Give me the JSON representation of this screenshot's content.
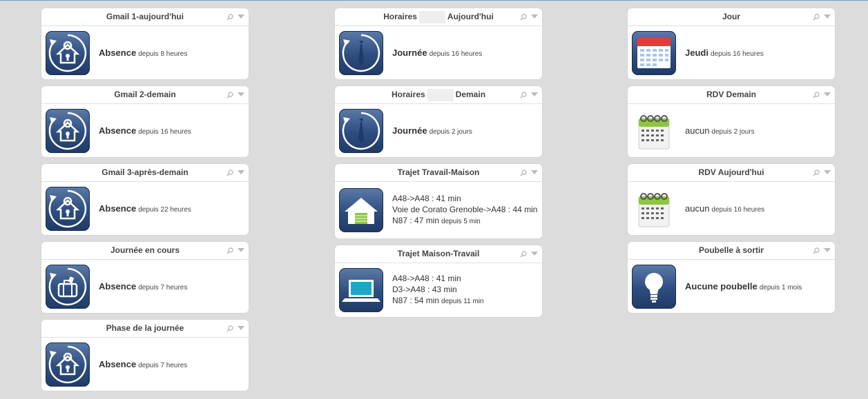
{
  "tools": {
    "search": "search-icon",
    "menu": "dropdown-icon"
  },
  "colors": {
    "background": "#dcdcdc",
    "icon_blue": "#2e4d7f",
    "calendar_red": "#e8383d",
    "calendar_green": "#8dc63f",
    "screen_cyan": "#1aa8c8"
  },
  "col1": [
    {
      "title": "Gmail 1-aujourd'hui",
      "state": "Absence",
      "since": "depuis 8 heures"
    },
    {
      "title": "Gmail 2-demain",
      "state": "Absence",
      "since": "depuis 16 heures"
    },
    {
      "title": "Gmail 3-après-demain",
      "state": "Absence",
      "since": "depuis 22 heures"
    },
    {
      "title": "Journée en cours",
      "state": "Absence",
      "since": "depuis 7 heures"
    },
    {
      "title": "Phase de la journée",
      "state": "Absence",
      "since": "depuis 7 heures"
    }
  ],
  "col2": [
    {
      "title_a": "Horaires",
      "title_b": "Aujourd'hui",
      "state": "Journée",
      "since": "depuis 16 heures"
    },
    {
      "title_a": "Horaires",
      "title_b": "Demain",
      "state": "Journée",
      "since": "depuis 2 jours"
    },
    {
      "title": "Trajet Travail-Maison",
      "lines": [
        "A48->A48 : 41 min",
        "Voie de Corato Grenoble->A48 : 44 min",
        "N87 : 47 min"
      ],
      "since": "depuis 5 min"
    },
    {
      "title": "Trajet Maison-Travail",
      "lines": [
        "A48->A48 : 41 min",
        "D3->A48 : 43 min",
        "N87 : 54 min"
      ],
      "since": "depuis 11 min"
    }
  ],
  "col3": [
    {
      "title": "Jour",
      "state": "Jeudi",
      "since": "depuis 16 heures"
    },
    {
      "title": "RDV Demain",
      "state": "aucun",
      "since": "depuis 2 jours"
    },
    {
      "title": "RDV Aujourd'hui",
      "state": "aucun",
      "since": "depuis 16 heures"
    },
    {
      "title": "Poubelle à sortir",
      "state": "Aucune poubelle",
      "since": "depuis 1 mois"
    }
  ]
}
